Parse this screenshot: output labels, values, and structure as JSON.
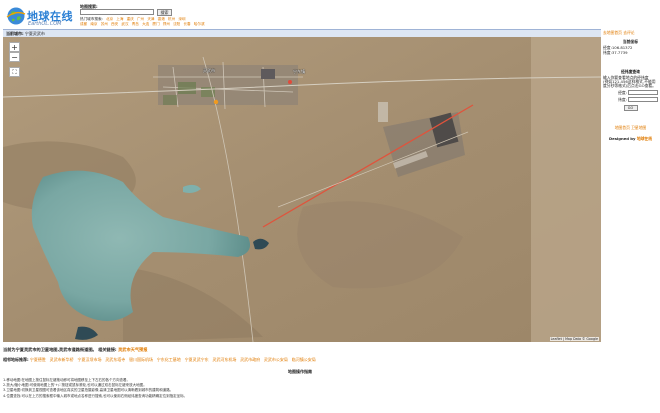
{
  "header": {
    "logo_cn": "地球在线",
    "logo_en": "EarthOL.COM",
    "search_label": "地图搜索:",
    "search_value": "",
    "search_button": "搜索",
    "hot_label": "热门城市搜索:",
    "hot_cities_row1": [
      "北京",
      "上海",
      "重庆",
      "广州",
      "天津",
      "香港",
      "杭州",
      "深圳"
    ],
    "hot_cities_row2": [
      "成都",
      "南京",
      "苏州",
      "西安",
      "武汉",
      "青岛",
      "大连",
      "厦门",
      "郑州",
      "沈阳",
      "长春",
      "哈尔滨"
    ]
  },
  "location_bar": {
    "label": "当前城市:",
    "city": "宁夏灵武市"
  },
  "top_right": {
    "link1": "去地图首页",
    "link2": "去评论"
  },
  "map": {
    "labels": [
      "灵武市",
      "宁东镇"
    ],
    "attribution": "Leaflet | Map Data © Google"
  },
  "right_panel": {
    "title": "当前坐标",
    "lon": "经度:106.81372",
    "lat": "纬度:37.7739",
    "sub_title": "经纬度查询",
    "desc": [
      "输入你要查看地点的经纬度",
      "(例如121.456这样格式,不能用度分秒等格式)后点击GO查看。"
    ],
    "lon_label": "经度:",
    "lat_label": "纬度:",
    "go_button": "GO",
    "link_a": "地图首页",
    "link_b": "卫星地图",
    "designed_prefix": "Designed by",
    "designed_by": "地球在线"
  },
  "info_line": {
    "text": "当前为宁夏灵武市的卫星地图,灵武市道路街道图。 相关链接:",
    "link": "灵武市天气预报"
  },
  "nearby": {
    "label": "相邻地标推荐:",
    "items": [
      "宁夏德胜",
      "灵武市新华桥",
      "宁夏汉坝市场",
      "灵武东塔寺",
      "银川国际机场",
      "宁东化工基地",
      "宁夏灵武宁东",
      "灵武河东机场",
      "灵武市政府",
      "灵武市公安局",
      "临河镇公安局"
    ]
  },
  "help": {
    "title": "地图操作指南",
    "notes": [
      "1.移动地图:在地图上按住鼠标左键拖动即可将地图移至上下左右的各个方向查看。",
      "2.放大/缩小地图:可使用地图上的'+/-'按钮或鼠标滚轮,也可以通过双击鼠标左键来放大地图。",
      "3.卫星地图:切换到卫星视图可查看该地区真实的卫星拍摄影像,高清卫星地图可以清晰看到城市的建筑和道路。",
      "4.位置查找:可以在上方的搜索框中输入城市或地点名称进行搜索,也可以使用右侧经纬度查询功能精确定位到指定坐标。"
    ]
  }
}
